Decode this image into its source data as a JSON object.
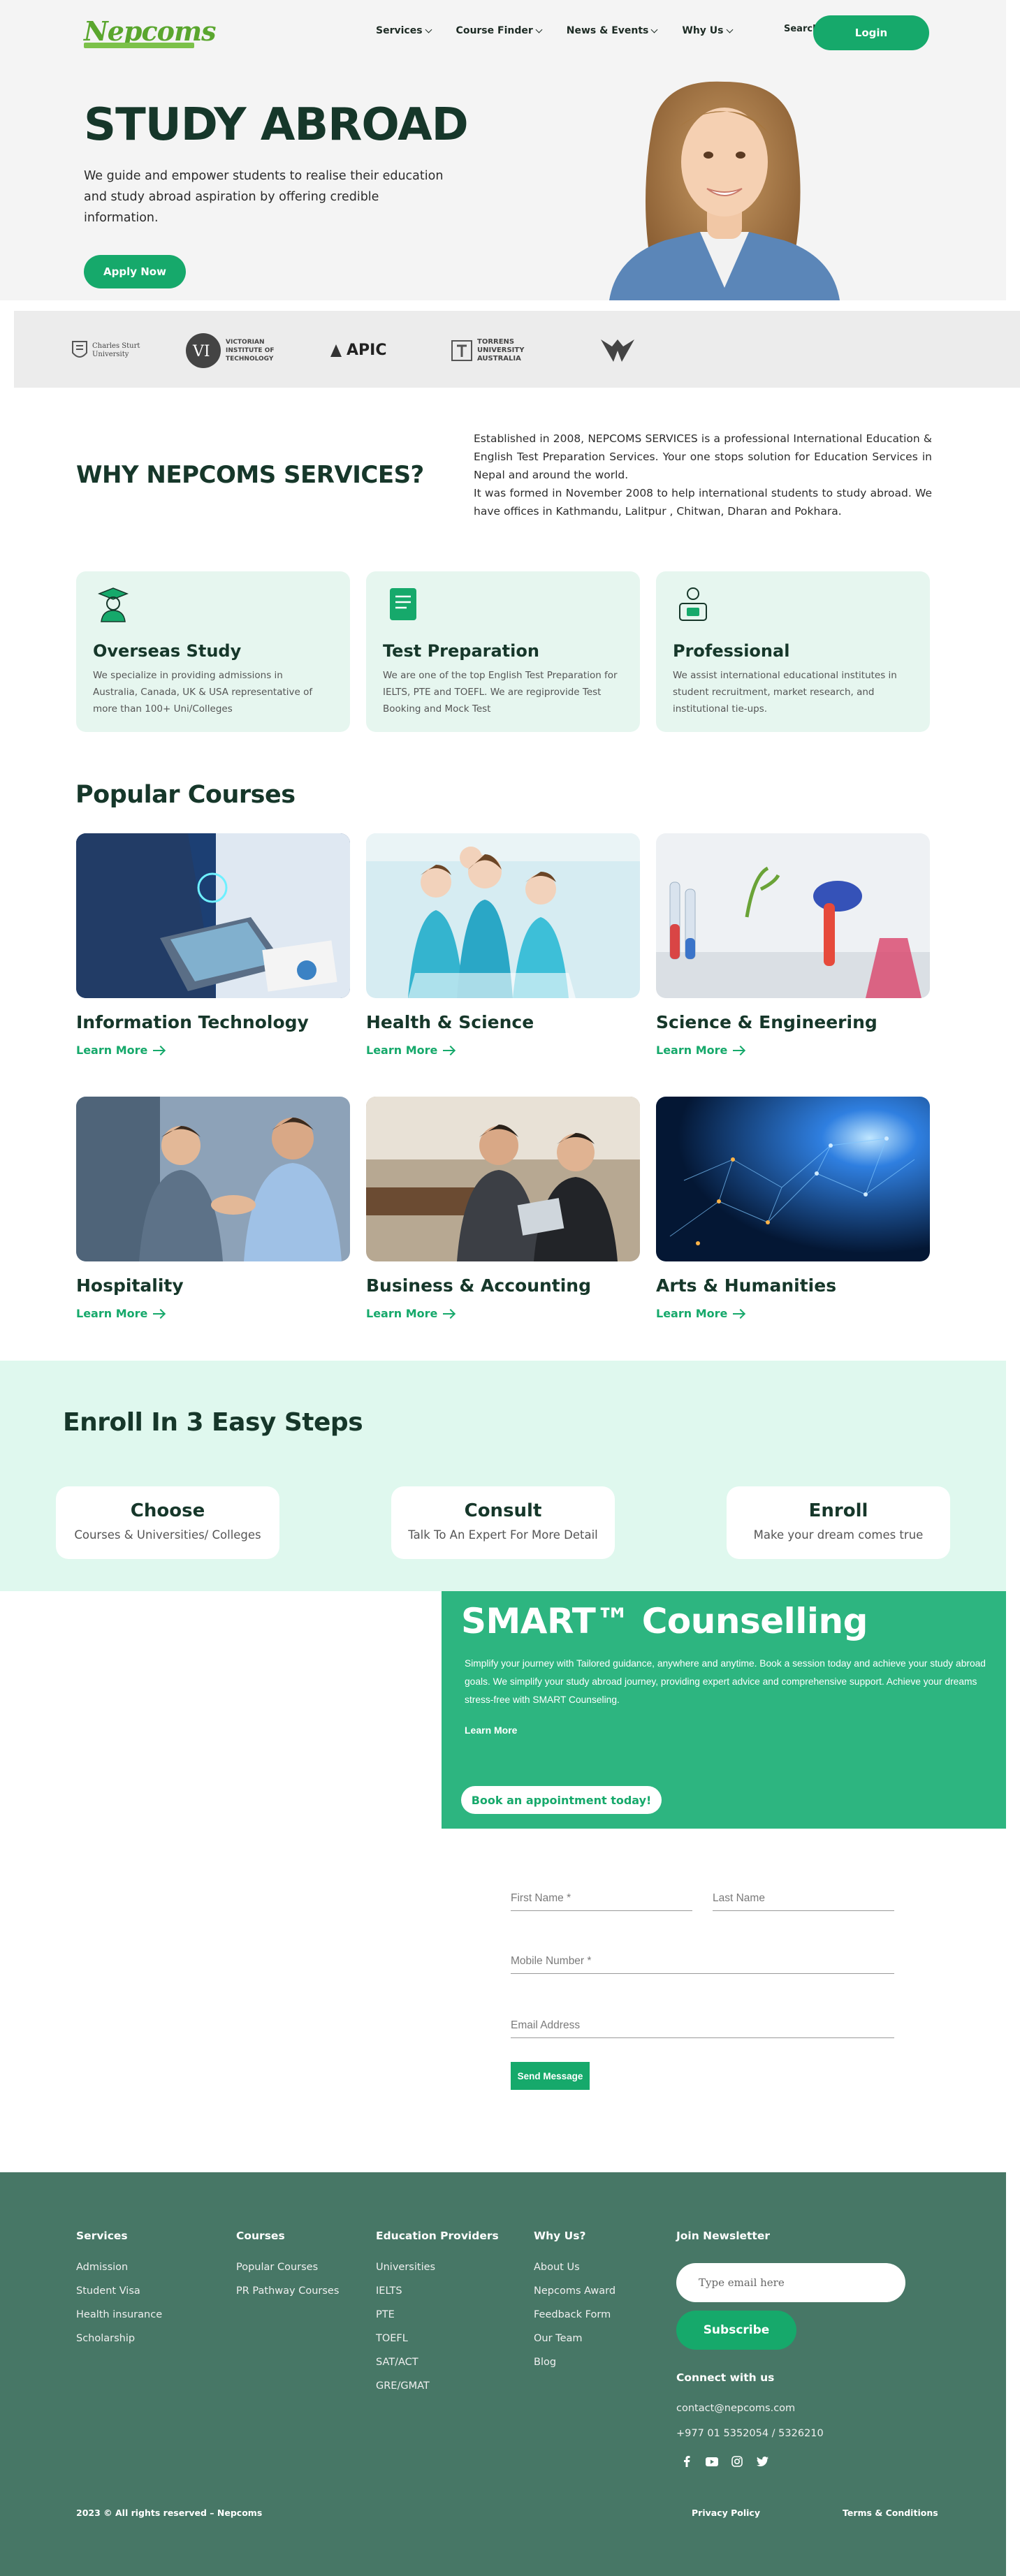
{
  "header": {
    "logo_text": "Nepcoms",
    "nav": [
      "Services",
      "Course Finder",
      "News & Events",
      "Why Us"
    ],
    "search_label": "Search",
    "login_label": "Login"
  },
  "hero": {
    "title": "STUDY ABROAD",
    "text": "We guide and empower students to realise their education and study abroad aspiration by offering credible information.",
    "apply_label": "Apply Now"
  },
  "partners": [
    {
      "name": "Charles Sturt University",
      "icon": "charles-sturt-logo"
    },
    {
      "name": "VICTORIAN INSTITUTE OF TECHNOLOGY",
      "icon": "vit-logo"
    },
    {
      "name": "APIC",
      "icon": "apic-logo"
    },
    {
      "name": "TORRENS UNIVERSITY AUSTRALIA",
      "icon": "torrens-logo"
    },
    {
      "name": "",
      "icon": "wings-logo"
    }
  ],
  "why": {
    "title": "WHY NEPCOMS SERVICES?",
    "para1": "Established in 2008, NEPCOMS SERVICES is a professional International Education & English Test Preparation Services. Your one stops solution for Education Services in Nepal and around the world.",
    "para2": "It was formed in November 2008 to help international students to study abroad. We have offices in Kathmandu, Lalitpur , Chitwan, Dharan and Pokhara."
  },
  "services": [
    {
      "title": "Overseas Study",
      "text": "We specialize in providing admissions in Australia, Canada, UK & USA representative of more than 100+ Uni/Colleges",
      "icon": "graduate-icon"
    },
    {
      "title": "Test Preparation",
      "text": "We are one of the top English Test Preparation for IELTS, PTE and TOEFL. We are regiprovide Test Booking and Mock Test",
      "icon": "book-icon"
    },
    {
      "title": "Professional",
      "text": "We assist international educational institutes in student recruitment, market research, and institutional tie-ups.",
      "icon": "professional-icon"
    }
  ],
  "courses": {
    "title": "Popular Courses",
    "learn_more": "Learn More",
    "items": [
      {
        "name": "Information Technology"
      },
      {
        "name": "Health & Science"
      },
      {
        "name": "Science & Engineering"
      },
      {
        "name": "Hospitality"
      },
      {
        "name": "Business & Accounting"
      },
      {
        "name": "Arts & Humanities"
      }
    ]
  },
  "enroll": {
    "title": "Enroll In 3 Easy Steps",
    "steps": [
      {
        "title": "Choose",
        "sub": "Courses & Universities/ Colleges"
      },
      {
        "title": "Consult",
        "sub": "Talk To An Expert For More Detail"
      },
      {
        "title": "Enroll",
        "sub": "Make your dream comes true"
      }
    ]
  },
  "smart": {
    "title": "SMART™ Counselling",
    "text": "Simplify your journey with Tailored guidance, anywhere and anytime. Book a session today and achieve your study abroad goals. We simplify your study abroad journey, providing expert advice and comprehensive support. Achieve your dreams stress-free with SMART Counseling.",
    "learn_more": "Learn More",
    "book_label": "Book an appointment today!"
  },
  "form": {
    "first_name": "First Name *",
    "last_name": "Last Name",
    "mobile": "Mobile Number *",
    "email": "Email Address",
    "send_label": "Send Message"
  },
  "footer": {
    "services": {
      "title": "Services",
      "links": [
        "Admission",
        "Student Visa",
        "Health insurance",
        "Scholarship"
      ]
    },
    "courses": {
      "title": "Courses",
      "links": [
        "Popular Courses",
        "PR Pathway Courses"
      ]
    },
    "providers": {
      "title": "Education Providers",
      "links": [
        "Universities",
        "IELTS",
        "PTE",
        "TOEFL",
        "SAT/ACT",
        "GRE/GMAT"
      ]
    },
    "why": {
      "title": "Why Us?",
      "links": [
        "About Us",
        "Nepcoms Award",
        "Feedback Form",
        "Our Team",
        "Blog"
      ]
    },
    "newsletter": {
      "title": "Join Newsletter",
      "placeholder": "Type email here",
      "subscribe_label": "Subscribe"
    },
    "connect": {
      "title": "Connect with us",
      "email": "contact@nepcoms.com",
      "phone": "+977 01 5352054 / 5326210"
    },
    "socials": [
      "facebook-icon",
      "youtube-icon",
      "instagram-icon",
      "twitter-icon"
    ],
    "copyright": "2023 © All rights reserved – Nepcoms",
    "privacy": "Privacy Policy",
    "terms": "Terms & Conditions"
  },
  "colors": {
    "brand": "#16a96b",
    "dark": "#16372a",
    "footer": "#477766",
    "mint": "#dff8ee",
    "smart": "#2db580"
  }
}
